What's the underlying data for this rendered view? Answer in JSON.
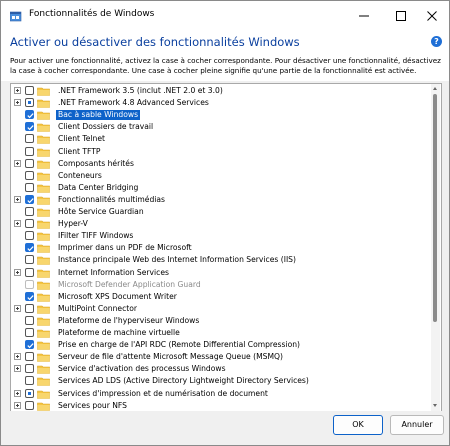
{
  "window": {
    "title": "Fonctionnalités de Windows",
    "icon": "windows-features-icon"
  },
  "header": {
    "heading": "Activer ou désactiver des fonctionnalités Windows",
    "help_icon": "?",
    "description": "Pour activer une fonctionnalité, activez la case à cocher correspondante. Pour désactiver une fonctionnalité, désactivez la case à cocher correspondante. Une case à cocher pleine signifie qu'une partie de la fonctionnalité est activée."
  },
  "features": [
    {
      "label": ".NET Framework 3.5 (inclut .NET 2.0 et 3.0)",
      "state": "unchecked",
      "expandable": true
    },
    {
      "label": ".NET Framework 4.8 Advanced Services",
      "state": "partial",
      "expandable": true
    },
    {
      "label": "Bac à sable Windows",
      "state": "checked",
      "expandable": false,
      "selected": true
    },
    {
      "label": "Client Dossiers de travail",
      "state": "checked",
      "expandable": false
    },
    {
      "label": "Client Telnet",
      "state": "unchecked",
      "expandable": false
    },
    {
      "label": "Client TFTP",
      "state": "unchecked",
      "expandable": false
    },
    {
      "label": "Composants hérités",
      "state": "unchecked",
      "expandable": true
    },
    {
      "label": "Conteneurs",
      "state": "unchecked",
      "expandable": false
    },
    {
      "label": "Data Center Bridging",
      "state": "unchecked",
      "expandable": false
    },
    {
      "label": "Fonctionnalités multimédias",
      "state": "checked",
      "expandable": true
    },
    {
      "label": "Hôte Service Guardian",
      "state": "unchecked",
      "expandable": false
    },
    {
      "label": "Hyper-V",
      "state": "unchecked",
      "expandable": true
    },
    {
      "label": "IFilter TIFF Windows",
      "state": "unchecked",
      "expandable": false
    },
    {
      "label": "Imprimer dans un PDF de Microsoft",
      "state": "checked",
      "expandable": false
    },
    {
      "label": "Instance principale Web des Internet Information Services (IIS)",
      "state": "unchecked",
      "expandable": false
    },
    {
      "label": "Internet Information Services",
      "state": "unchecked",
      "expandable": true
    },
    {
      "label": "Microsoft Defender Application Guard",
      "state": "disabled",
      "expandable": false
    },
    {
      "label": "Microsoft XPS Document Writer",
      "state": "checked",
      "expandable": false
    },
    {
      "label": "MultiPoint Connector",
      "state": "unchecked",
      "expandable": true
    },
    {
      "label": "Plateforme de l'hyperviseur Windows",
      "state": "unchecked",
      "expandable": false
    },
    {
      "label": "Plateforme de machine virtuelle",
      "state": "unchecked",
      "expandable": false
    },
    {
      "label": "Prise en charge de l'API RDC (Remote Differential Compression)",
      "state": "checked",
      "expandable": false
    },
    {
      "label": "Serveur de file d'attente Microsoft Message Queue (MSMQ)",
      "state": "unchecked",
      "expandable": true
    },
    {
      "label": "Service d'activation des processus Windows",
      "state": "unchecked",
      "expandable": true
    },
    {
      "label": "Services AD LDS (Active Directory Lightweight Directory Services)",
      "state": "unchecked",
      "expandable": false
    },
    {
      "label": "Services d'impression et de numérisation de document",
      "state": "partial",
      "expandable": true
    },
    {
      "label": "Services pour NFS",
      "state": "unchecked",
      "expandable": true
    }
  ],
  "buttons": {
    "ok": "OK",
    "cancel": "Annuler"
  },
  "colors": {
    "accent": "#1f6fd6",
    "selection": "#0d62c9",
    "heading": "#0a3f9e",
    "folder": "#f5c542"
  }
}
